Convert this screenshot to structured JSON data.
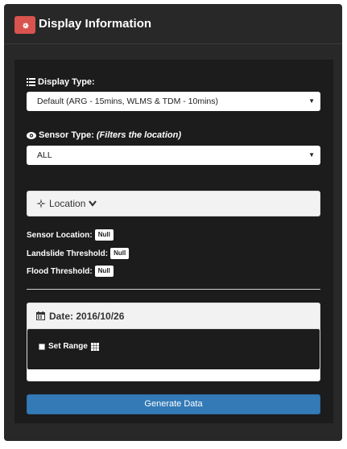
{
  "panel": {
    "title": "Display Information",
    "header_icon": "gear-icon"
  },
  "display_type": {
    "label": "Display Type:",
    "icon": "list-icon",
    "selected": "Default (ARG - 15mins, WLMS & TDM - 10mins)"
  },
  "sensor_type": {
    "label": "Sensor Type: ",
    "hint": "(Filters the location)",
    "icon": "eye-icon",
    "selected": "ALL"
  },
  "location": {
    "label": "Location",
    "icon": "crosshair-icon",
    "toggle_icon": "chevron-down-icon"
  },
  "info": {
    "sensor_location_label": "Sensor Location:",
    "sensor_location_value": "Null",
    "landslide_label": "Landslide Threshold:",
    "landslide_value": "Null",
    "flood_label": "Flood Threshold:",
    "flood_value": "Null"
  },
  "date": {
    "label": "Date: 2016/10/26",
    "icon": "calendar-icon",
    "set_range_label": "Set Range",
    "set_range_icon": "grid-icon"
  },
  "actions": {
    "generate_label": "Generate Data"
  },
  "colors": {
    "panel_bg": "#282828",
    "inner_bg": "#1c1c1c",
    "header_button": "#d9534f",
    "primary": "#337ab7"
  }
}
